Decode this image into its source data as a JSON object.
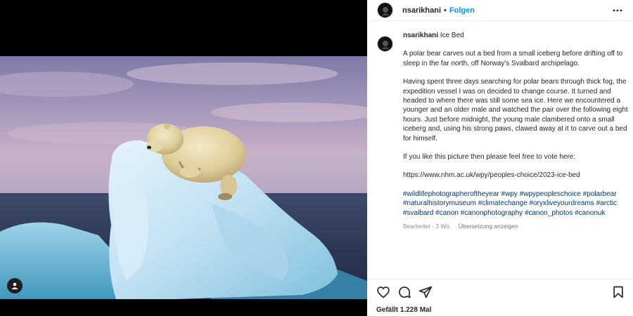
{
  "post": {
    "username": "nsarikhani",
    "dot": "•",
    "follow_label": "Folgen",
    "caption_title": "Ice Bed",
    "caption_p1": "A polar bear carves out a bed from a small iceberg before drifting off to sleep in the far north, off Norway's Svalbard archipelago.",
    "caption_p2": "Having spent three days searching for polar bears through thick fog, the expedition vessel I was on decided to change course. It turned and headed to where there was still some sea ice. Here we encountered a younger and an older male and watched the pair over the following eight hours. Just before midnight, the young male clambered onto a small iceberg and, using his strong paws, clawed away at it to carve out a bed for himself.",
    "caption_p3": "If you like this picture then please feel free to vote here:",
    "caption_link": "https://www.nhm.ac.uk/wpy/peoples-choice/2023-ice-bed",
    "hashtags": [
      "#wildlifephotographeroftheyear",
      "#wpy",
      "#wpypeopleschoice",
      "#polarbear",
      "#naturalhistorymuseum",
      "#climatechange",
      "#oryxliveyourdreams",
      "#arctic",
      "#svalbard",
      "#canon",
      "#canonphotography",
      "#canon_photos",
      "#canonuk"
    ],
    "edited_label": "Bearbeitet · 3 Wo.",
    "translate_label": "Übersetzung anzeigen",
    "likes_label": "Gefällt 1.228 Mal"
  },
  "icons": {
    "more": "more-options-icon",
    "like": "heart-icon",
    "comment": "comment-icon",
    "share": "paper-plane-icon",
    "save": "bookmark-icon",
    "tag": "user-tag-icon"
  },
  "colors": {
    "link_blue": "#0095f6",
    "hashtag": "#00376b",
    "muted": "#8e8e8e"
  }
}
